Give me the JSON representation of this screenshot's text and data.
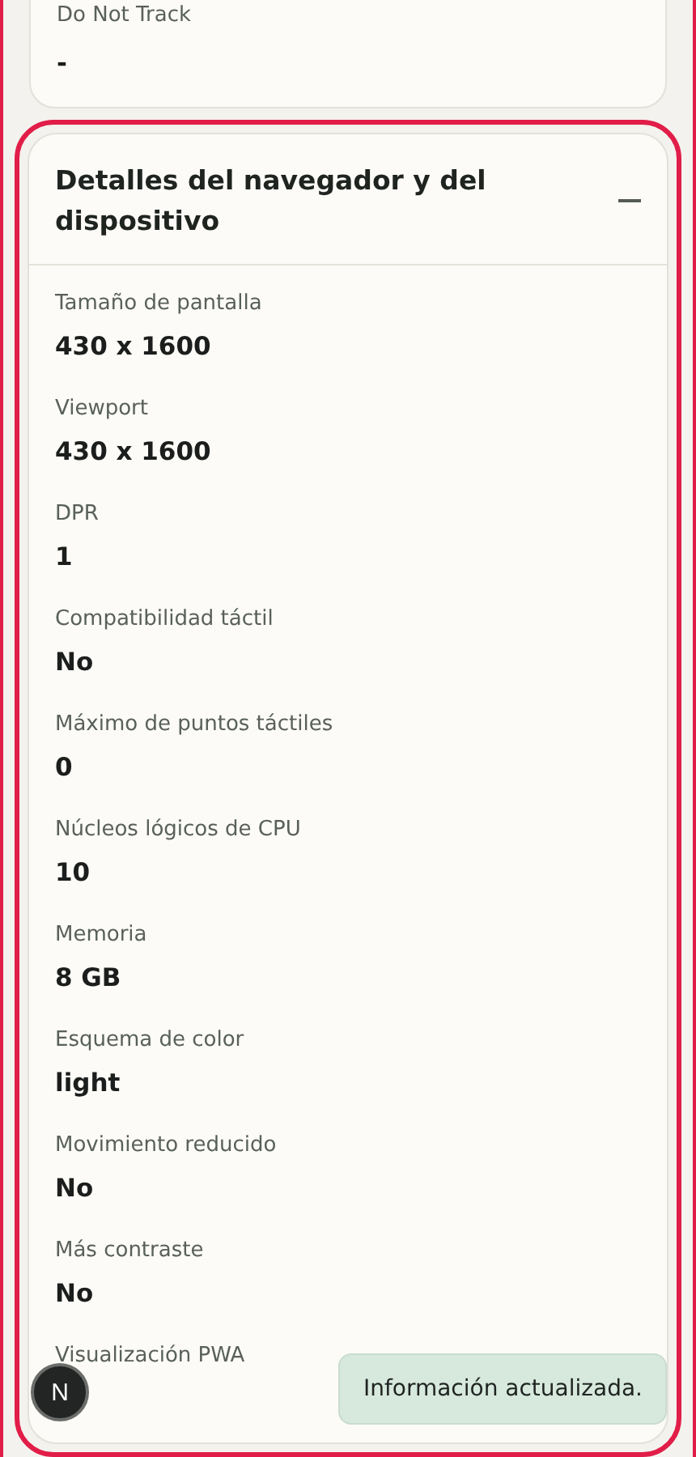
{
  "top_card": {
    "label": "Do Not Track",
    "value": "-"
  },
  "details": {
    "title": "Detalles del navegador y del dispositivo",
    "expanded": true,
    "focused": true,
    "items": [
      {
        "label": "Tamaño de pantalla",
        "value": "430 x 1600"
      },
      {
        "label": "Viewport",
        "value": "430 x 1600"
      },
      {
        "label": "DPR",
        "value": "1"
      },
      {
        "label": "Compatibilidad táctil",
        "value": "No"
      },
      {
        "label": "Máximo de puntos táctiles",
        "value": "0"
      },
      {
        "label": "Núcleos lógicos de CPU",
        "value": "10"
      },
      {
        "label": "Memoria",
        "value": "8 GB"
      },
      {
        "label": "Esquema de color",
        "value": "light"
      },
      {
        "label": "Movimiento reducido",
        "value": "No"
      },
      {
        "label": "Más contraste",
        "value": "No"
      },
      {
        "label": "Visualización PWA"
      }
    ]
  },
  "dev_badge": {
    "letter": "N"
  },
  "toast": {
    "message": "Información actualizada."
  }
}
